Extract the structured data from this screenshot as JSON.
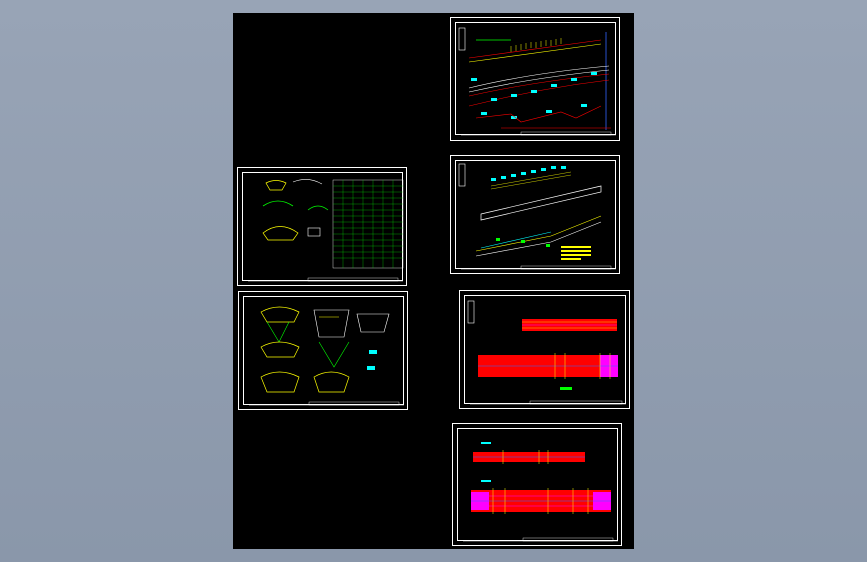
{
  "app": {
    "background_color": "#98a4b6",
    "model_space_color": "#000000"
  },
  "sheets": [
    {
      "id": "plan-profile-1",
      "kind": "drawing-sheet"
    },
    {
      "id": "plan-profile-2",
      "kind": "drawing-sheet"
    },
    {
      "id": "section-table",
      "kind": "drawing-sheet"
    },
    {
      "id": "detail-sections",
      "kind": "drawing-sheet"
    },
    {
      "id": "red-elevation-1",
      "kind": "drawing-sheet"
    },
    {
      "id": "red-elevation-2",
      "kind": "drawing-sheet"
    }
  ],
  "colors": {
    "line_white": "#ffffff",
    "line_yellow": "#ffff00",
    "line_cyan": "#00ffff",
    "line_green": "#00ff00",
    "line_red": "#ff0000",
    "fill_red": "#ff0000",
    "fill_magenta": "#ff00ff",
    "line_blue": "#3366ff"
  }
}
